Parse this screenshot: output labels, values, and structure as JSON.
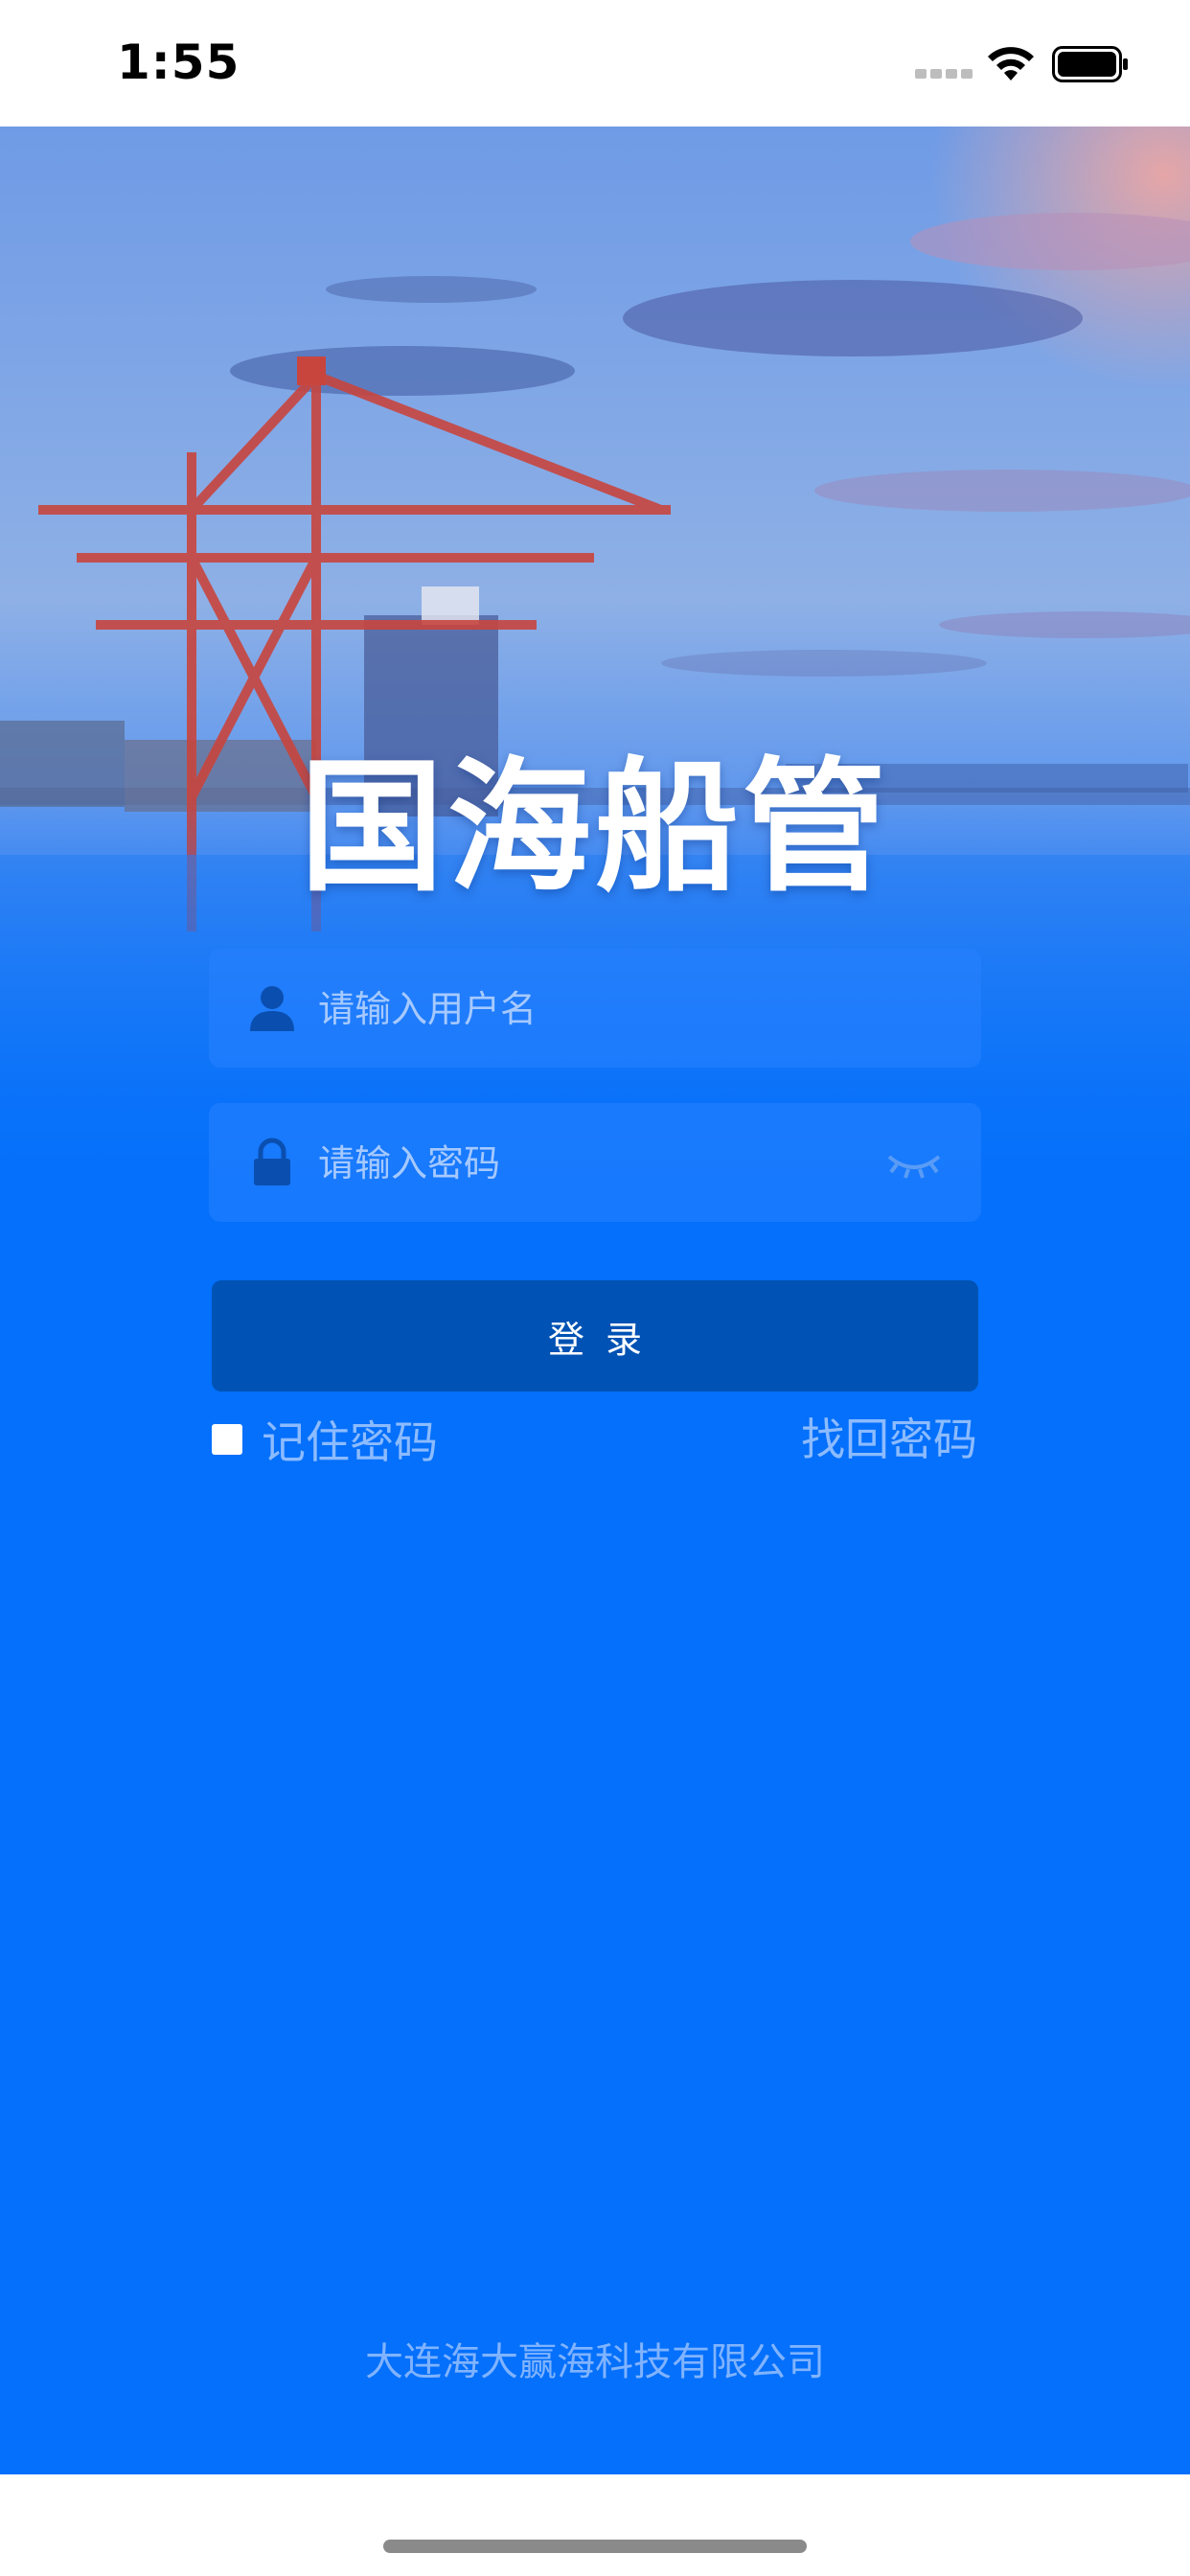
{
  "status_bar": {
    "time": "1:55"
  },
  "app": {
    "title": "国海船管"
  },
  "login_form": {
    "username_placeholder": "请输入用户名",
    "password_placeholder": "请输入密码",
    "login_label": "登录",
    "remember_label": "记住密码",
    "remember_checked": false,
    "find_password_label": "找回密码"
  },
  "footer": {
    "company": "大连海大赢海科技有限公司"
  },
  "icons": {
    "username": "user-icon",
    "password": "lock-icon",
    "visibility": "eye-closed-icon"
  },
  "colors": {
    "background_blue": "#0470fb",
    "button_blue": "#0052b4",
    "field_fill": "#2882ff",
    "white": "#ffffff"
  }
}
